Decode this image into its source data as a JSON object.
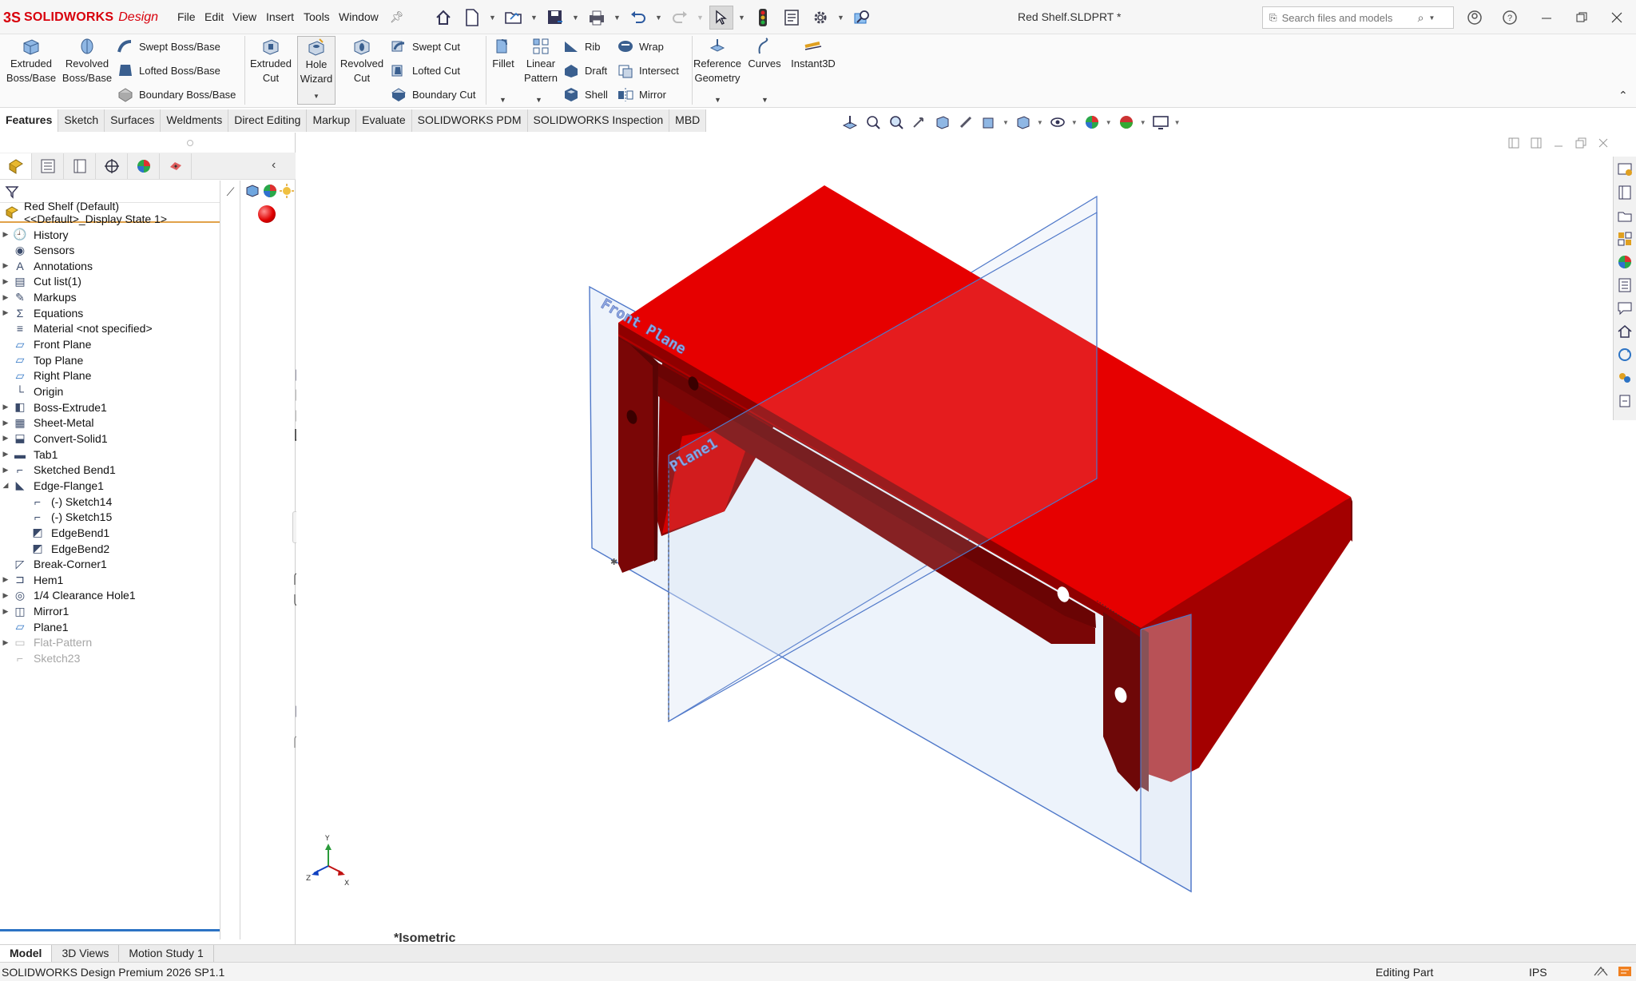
{
  "app": {
    "brand": "SOLIDWORKS",
    "edition": "Design",
    "document_title": "Red Shelf.SLDPRT *"
  },
  "menu": [
    "File",
    "Edit",
    "View",
    "Insert",
    "Tools",
    "Window"
  ],
  "search": {
    "placeholder": "Search files and models"
  },
  "toolbar": {
    "extruded_boss": "Extruded Boss/Base",
    "revolved_boss": "Revolved Boss/Base",
    "swept_boss": "Swept Boss/Base",
    "lofted_boss": "Lofted Boss/Base",
    "boundary_boss": "Boundary Boss/Base",
    "extruded_cut": "Extruded Cut",
    "hole_wizard": "Hole Wizard",
    "revolved_cut": "Revolved Cut",
    "swept_cut": "Swept Cut",
    "lofted_cut": "Lofted Cut",
    "boundary_cut": "Boundary Cut",
    "fillet": "Fillet",
    "linear_pattern": "Linear Pattern",
    "rib": "Rib",
    "draft": "Draft",
    "shell": "Shell",
    "wrap": "Wrap",
    "intersect": "Intersect",
    "mirror": "Mirror",
    "reference_geometry": "Reference Geometry",
    "curves": "Curves",
    "instant3d": "Instant3D"
  },
  "command_tabs": [
    "Features",
    "Sketch",
    "Surfaces",
    "Weldments",
    "Direct Editing",
    "Markup",
    "Evaluate",
    "SOLIDWORKS PDM",
    "SOLIDWORKS Inspection",
    "MBD"
  ],
  "feature_tree": {
    "root": "Red Shelf (Default) <<Default>_Display State 1>",
    "items": [
      {
        "label": "History",
        "icon": "history-icon"
      },
      {
        "label": "Sensors",
        "icon": "sensors-icon"
      },
      {
        "label": "Annotations",
        "icon": "annotations-icon"
      },
      {
        "label": "Cut list(1)",
        "icon": "cut-list-icon"
      },
      {
        "label": "Markups",
        "icon": "markups-icon"
      },
      {
        "label": "Equations",
        "icon": "equations-icon"
      },
      {
        "label": "Material <not specified>",
        "icon": "material-icon"
      },
      {
        "label": "Front Plane",
        "icon": "plane-icon"
      },
      {
        "label": "Top Plane",
        "icon": "plane-icon"
      },
      {
        "label": "Right Plane",
        "icon": "plane-icon"
      },
      {
        "label": "Origin",
        "icon": "origin-icon"
      },
      {
        "label": "Boss-Extrude1",
        "icon": "boss-extrude-icon"
      },
      {
        "label": "Sheet-Metal",
        "icon": "sheet-metal-icon"
      },
      {
        "label": "Convert-Solid1",
        "icon": "convert-solid-icon"
      },
      {
        "label": "Tab1",
        "icon": "tab-icon"
      },
      {
        "label": "Sketched Bend1",
        "icon": "sketched-bend-icon"
      },
      {
        "label": "Edge-Flange1",
        "icon": "edge-flange-icon"
      },
      {
        "label": "(-) Sketch14",
        "icon": "sketch-icon"
      },
      {
        "label": "(-) Sketch15",
        "icon": "sketch-icon"
      },
      {
        "label": "EdgeBend1",
        "icon": "edge-bend-icon"
      },
      {
        "label": "EdgeBend2",
        "icon": "edge-bend-icon"
      },
      {
        "label": "Break-Corner1",
        "icon": "break-corner-icon"
      },
      {
        "label": "Hem1",
        "icon": "hem-icon"
      },
      {
        "label": "1/4 Clearance Hole1",
        "icon": "hole-icon"
      },
      {
        "label": "Mirror1",
        "icon": "mirror-icon"
      },
      {
        "label": "Plane1",
        "icon": "plane-icon"
      },
      {
        "label": "Flat-Pattern",
        "icon": "flat-pattern-icon"
      },
      {
        "label": "Sketch23",
        "icon": "sketch-icon"
      }
    ]
  },
  "viewport": {
    "view_name": "*Isometric",
    "plane_labels": [
      "Front Plane",
      "Plane1"
    ],
    "axis_labels": [
      "Y",
      "Z",
      "X"
    ],
    "part_color": "#e60000",
    "part_side_color": "#9e0000",
    "part_dark_color": "#6e0808",
    "plane_color": "#4f78c9"
  },
  "bottom_tabs": [
    "Model",
    "3D Views",
    "Motion Study 1"
  ],
  "status": {
    "product": "SOLIDWORKS Design Premium 2026 SP1.1",
    "mode": "Editing Part",
    "units": "IPS"
  }
}
